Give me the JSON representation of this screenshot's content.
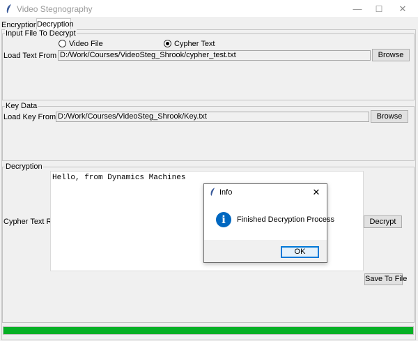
{
  "window": {
    "title": "Video Stegnography",
    "minimize": "—",
    "maximize": "☐",
    "close": "✕"
  },
  "tabs": [
    {
      "label": "Encryption"
    },
    {
      "label": "Decryption"
    }
  ],
  "input_group": {
    "legend": "Input File To Decrypt",
    "radio_video": "Video File",
    "radio_cypher": "Cypher Text",
    "selected": "Cypher Text",
    "load_label": "Load Text From File",
    "path": "D:/Work/Courses/VideoSteg_Shrook/cypher_test.txt",
    "browse": "Browse"
  },
  "key_group": {
    "legend": "Key Data",
    "load_label": "Load Key From File",
    "path": "D:/Work/Courses/VideoSteg_Shrook/Key.txt",
    "browse": "Browse"
  },
  "decryption_group": {
    "legend": "Decryption",
    "label": "Cypher Text Raw",
    "text": "Hello, from Dynamics Machines",
    "decrypt_button": "Decrypt",
    "save_button": "Save To File"
  },
  "progress": {
    "value": 1.0,
    "color": "#06b025"
  },
  "dialog": {
    "title": "Info",
    "close": "✕",
    "icon": "info-icon",
    "icon_glyph": "i",
    "message": "Finished Decryption Process",
    "ok": "OK"
  }
}
